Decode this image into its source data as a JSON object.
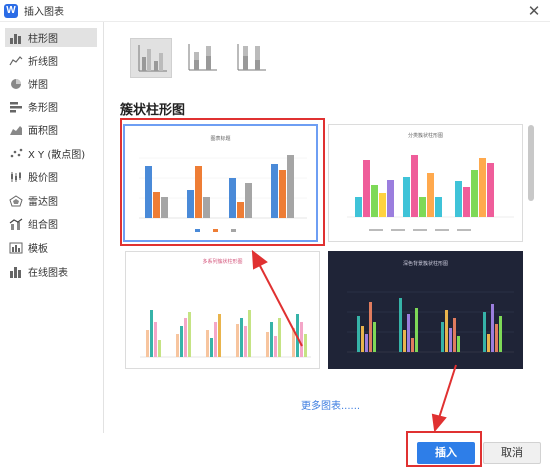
{
  "window": {
    "logo": "W",
    "title": "插入图表",
    "close_icon": "close-icon"
  },
  "sidebar": {
    "items": [
      {
        "label": "柱形图",
        "icon": "bar-chart-icon",
        "active": true
      },
      {
        "label": "折线图",
        "icon": "line-chart-icon"
      },
      {
        "label": "饼图",
        "icon": "pie-chart-icon"
      },
      {
        "label": "条形图",
        "icon": "horizontal-bar-icon"
      },
      {
        "label": "面积图",
        "icon": "area-chart-icon"
      },
      {
        "label": "X Y (散点图)",
        "icon": "scatter-chart-icon"
      },
      {
        "label": "股价图",
        "icon": "stock-chart-icon"
      },
      {
        "label": "雷达图",
        "icon": "radar-chart-icon"
      },
      {
        "label": "组合图",
        "icon": "combo-chart-icon"
      },
      {
        "label": "模板",
        "icon": "template-icon"
      },
      {
        "label": "在线图表",
        "icon": "online-chart-icon"
      }
    ]
  },
  "main": {
    "chart_types": [
      {
        "name": "clustered-column",
        "selected": true
      },
      {
        "name": "stacked-column"
      },
      {
        "name": "percent-stacked-column"
      }
    ],
    "section_title": "簇状柱形图",
    "templates": [
      {
        "name": "template-1",
        "title": "图表标题",
        "selected": true
      },
      {
        "name": "template-2",
        "title": "分类簇状柱形图"
      },
      {
        "name": "template-3",
        "title": "多系列簇状柱形图"
      },
      {
        "name": "template-4",
        "title": "深色背景簇状柱形图",
        "dark": true
      }
    ],
    "more_link": "更多图表......"
  },
  "footer": {
    "insert_label": "插入",
    "cancel_label": "取消"
  },
  "colors": {
    "accent": "#2e7ee8",
    "highlight": "#e03131",
    "sidebar_active": "#e2e2e2"
  }
}
